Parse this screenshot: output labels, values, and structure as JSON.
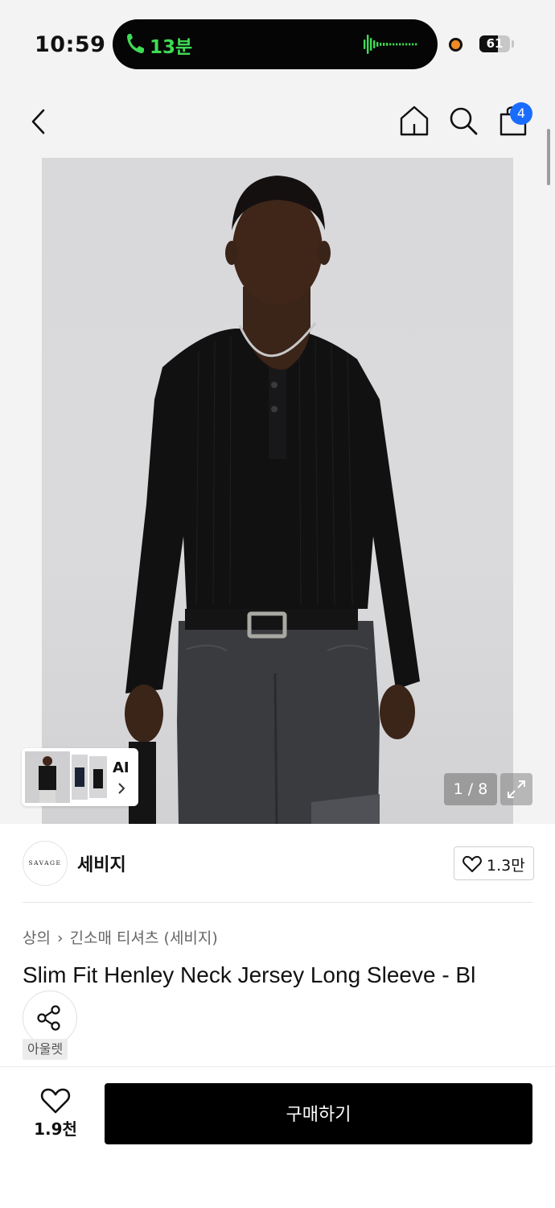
{
  "status_bar": {
    "time": "10:59",
    "call_duration": "13분",
    "battery": "61"
  },
  "header": {
    "cart_count": "4",
    "icons": [
      "back-icon",
      "home-icon",
      "search-icon",
      "cart-icon"
    ]
  },
  "gallery": {
    "ai_label": "AI",
    "counter": "1 / 8"
  },
  "brand": {
    "logo_text": "SAVAGE",
    "name": "세비지",
    "likes": "1.3만"
  },
  "breadcrumb": {
    "category": "상의",
    "subcategory": "긴소매 티셔츠 (세비지)"
  },
  "product": {
    "title": "Slim Fit Henley Neck Jersey Long Sleeve - Bl",
    "tag": "아울렛"
  },
  "bottom_bar": {
    "likes": "1.9천",
    "buy_label": "구매하기"
  },
  "colors": {
    "call_green": "#3fdb55",
    "badge_blue": "#1a6cff",
    "buy_button": "#000000"
  }
}
